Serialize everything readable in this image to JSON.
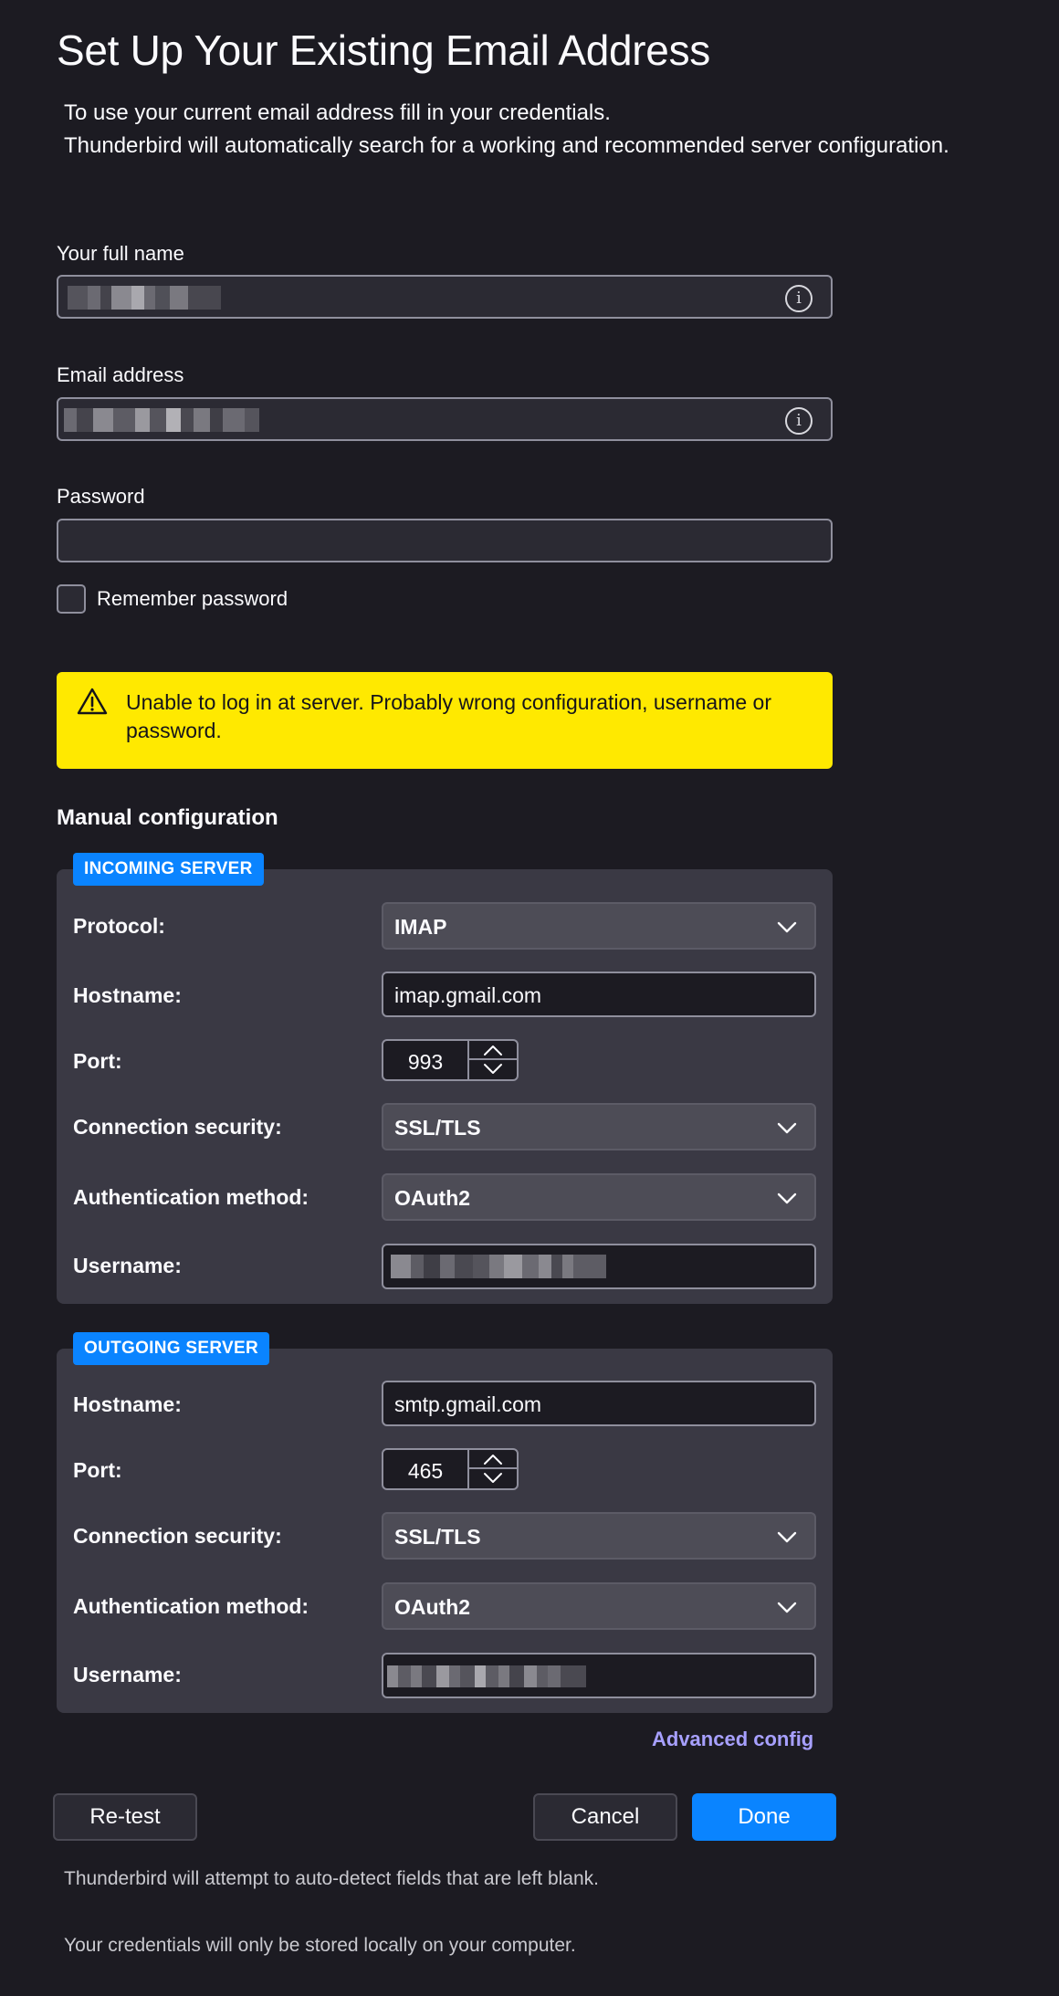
{
  "page": {
    "title": "Set Up Your Existing Email Address",
    "subtitle_line1": "To use your current email address fill in your credentials.",
    "subtitle_line2": "Thunderbird will automatically search for a working and recommended server configuration."
  },
  "form": {
    "full_name_label": "Your full name",
    "full_name_value": "",
    "email_label": "Email address",
    "email_value": "",
    "password_label": "Password",
    "password_value": "",
    "remember_label": "Remember password",
    "info_glyph": "i"
  },
  "warning": {
    "icon": "warning-triangle-icon",
    "text": "Unable to log in at server. Probably wrong configuration, username or password."
  },
  "manual": {
    "title": "Manual configuration",
    "incoming": {
      "badge": "INCOMING SERVER",
      "protocol_label": "Protocol:",
      "protocol_value": "IMAP",
      "hostname_label": "Hostname:",
      "hostname_value": "imap.gmail.com",
      "port_label": "Port:",
      "port_value": "993",
      "security_label": "Connection security:",
      "security_value": "SSL/TLS",
      "auth_label": "Authentication method:",
      "auth_value": "OAuth2",
      "username_label": "Username:",
      "username_value": ""
    },
    "outgoing": {
      "badge": "OUTGOING SERVER",
      "hostname_label": "Hostname:",
      "hostname_value": "smtp.gmail.com",
      "port_label": "Port:",
      "port_value": "465",
      "security_label": "Connection security:",
      "security_value": "SSL/TLS",
      "auth_label": "Authentication method:",
      "auth_value": "OAuth2",
      "username_label": "Username:",
      "username_value": ""
    },
    "advanced_link": "Advanced config"
  },
  "buttons": {
    "retest": "Re-test",
    "cancel": "Cancel",
    "done": "Done"
  },
  "footer": {
    "note1": "Thunderbird will attempt to auto-detect fields that are left blank.",
    "note2": "Your credentials will only be stored locally on your computer."
  },
  "colors": {
    "background": "#1c1b22",
    "accent": "#0a84ff",
    "warning": "#ffe900",
    "link": "#a7a0ff"
  }
}
